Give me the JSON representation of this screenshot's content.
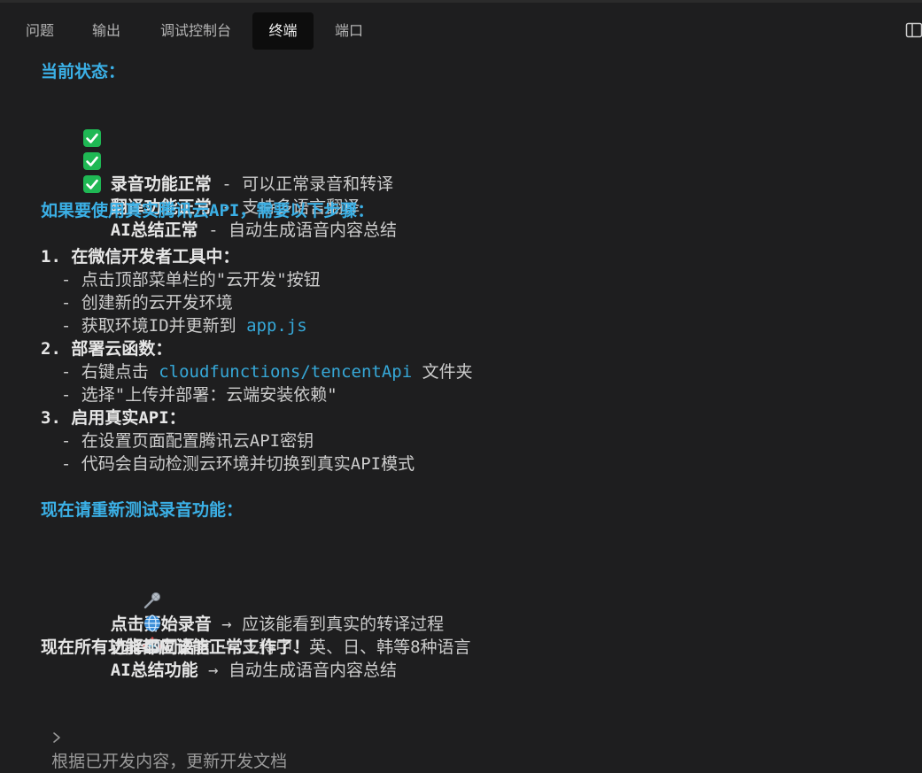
{
  "tabs": [
    {
      "label": "问题",
      "active": false
    },
    {
      "label": "输出",
      "active": false
    },
    {
      "label": "调试控制台",
      "active": false
    },
    {
      "label": "终端",
      "active": true
    },
    {
      "label": "端口",
      "active": false
    }
  ],
  "terminal": {
    "status_heading": "当前状态：",
    "status_items": [
      {
        "bold": "录音功能正常",
        "rest": " - 可以正常录音和转译"
      },
      {
        "bold": "翻译功能正常",
        "rest": " - 支持多语言翻译"
      },
      {
        "bold": "AI总结正常",
        "rest": " - 自动生成语音内容总结"
      }
    ],
    "api_heading": "如果要使用真实腾讯云API，需要以下步骤：",
    "steps": [
      {
        "title": "1. 在微信开发者工具中：",
        "sub": [
          {
            "text": "  - 点击顶部菜单栏的\"云开发\"按钮"
          },
          {
            "text": "  - 创建新的云开发环境"
          },
          {
            "text": "  - 获取环境ID并更新到 ",
            "code": "app.js"
          }
        ]
      },
      {
        "title": "2. 部署云函数：",
        "sub": [
          {
            "text": "  - 右键点击 ",
            "code": "cloudfunctions/tencentApi",
            "after": " 文件夹"
          },
          {
            "text": "  - 选择\"上传并部署：云端安装依赖\""
          }
        ]
      },
      {
        "title": "3. 启用真实API：",
        "sub": [
          {
            "text": "  - 在设置页面配置腾讯云API密钥"
          },
          {
            "text": "  - 代码会自动检测云环境并切换到真实API模式"
          }
        ]
      }
    ],
    "test_heading": "现在请重新测试录音功能：",
    "test_items": [
      {
        "icon": "microphone-icon",
        "bold": "点击开始录音",
        "rest": " → 应该能看到真实的转译过程"
      },
      {
        "icon": "globe-icon",
        "bold": "选择不同语言",
        "rest": " → 支持中、英、日、韩等8种语言"
      },
      {
        "icon": "robot-icon",
        "bold": "AI总结功能",
        "rest": " → 自动生成语音内容总结"
      }
    ],
    "final_line": "现在所有功能都应该能正常工作了！"
  },
  "prompt": {
    "text": "根据已开发内容，更新开发文档"
  },
  "colors": {
    "background": "#1e1e1f",
    "heading": "#3bb0e6",
    "code": "#36a8d8",
    "check": "#1fb854"
  }
}
